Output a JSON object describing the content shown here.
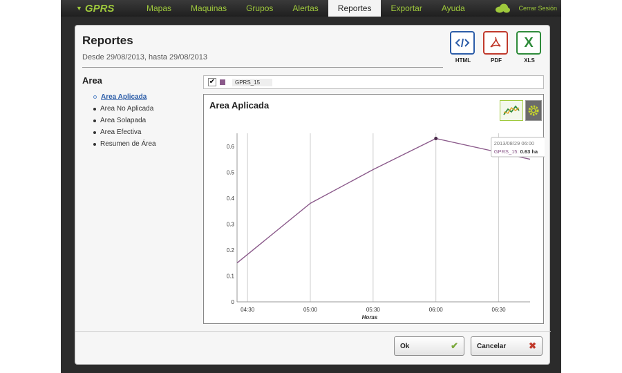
{
  "app": {
    "brand": "GPRS",
    "logout": "Cerrar Sesión"
  },
  "nav": {
    "items": [
      {
        "label": "Mapas"
      },
      {
        "label": "Maquinas"
      },
      {
        "label": "Grupos"
      },
      {
        "label": "Alertas"
      },
      {
        "label": "Reportes"
      },
      {
        "label": "Exportar"
      },
      {
        "label": "Ayuda"
      }
    ],
    "active": "Reportes"
  },
  "dialog": {
    "title": "Reportes",
    "subtitle": "Desde 29/08/2013, hasta 29/08/2013",
    "exports": [
      {
        "label": "HTML",
        "icon": "code-icon",
        "color": "#2b5ca8"
      },
      {
        "label": "PDF",
        "icon": "pdf-icon",
        "color": "#c0392b"
      },
      {
        "label": "XLS",
        "icon": "excel-icon",
        "color": "#2e8b3a"
      }
    ],
    "sidebar": {
      "title": "Area",
      "items": [
        {
          "label": "Area Aplicada",
          "active": true
        },
        {
          "label": "Area No Aplicada"
        },
        {
          "label": "Area Solapada"
        },
        {
          "label": "Area Efectiva"
        },
        {
          "label": "Resumen de Área"
        }
      ]
    },
    "series_selector": {
      "checked": true,
      "label": "GPRS_15",
      "color": "#8b5a8b"
    },
    "ok_label": "Ok",
    "cancel_label": "Cancelar"
  },
  "chart_data": {
    "type": "line",
    "title": "Area Aplicada",
    "xlabel": "Horas",
    "ylabel": "",
    "x_ticks": [
      "04:30",
      "05:00",
      "05:30",
      "06:00",
      "06:30"
    ],
    "y_ticks": [
      "0",
      "0.1",
      "0.2",
      "0.3",
      "0.4",
      "0.5",
      "0.6"
    ],
    "ylim": [
      0,
      0.65
    ],
    "xlim": [
      "04:25",
      "06:45"
    ],
    "grid": "vertical",
    "series": [
      {
        "name": "GPRS_15",
        "color": "#8b5a8b",
        "x": [
          "04:25",
          "05:00",
          "05:30",
          "06:00",
          "06:45"
        ],
        "y": [
          0.15,
          0.38,
          0.51,
          0.63,
          0.55
        ]
      }
    ],
    "tooltip": {
      "date": "2013/08/29 06:00",
      "series": "GPRS_15",
      "value": "0.63 ha"
    }
  }
}
